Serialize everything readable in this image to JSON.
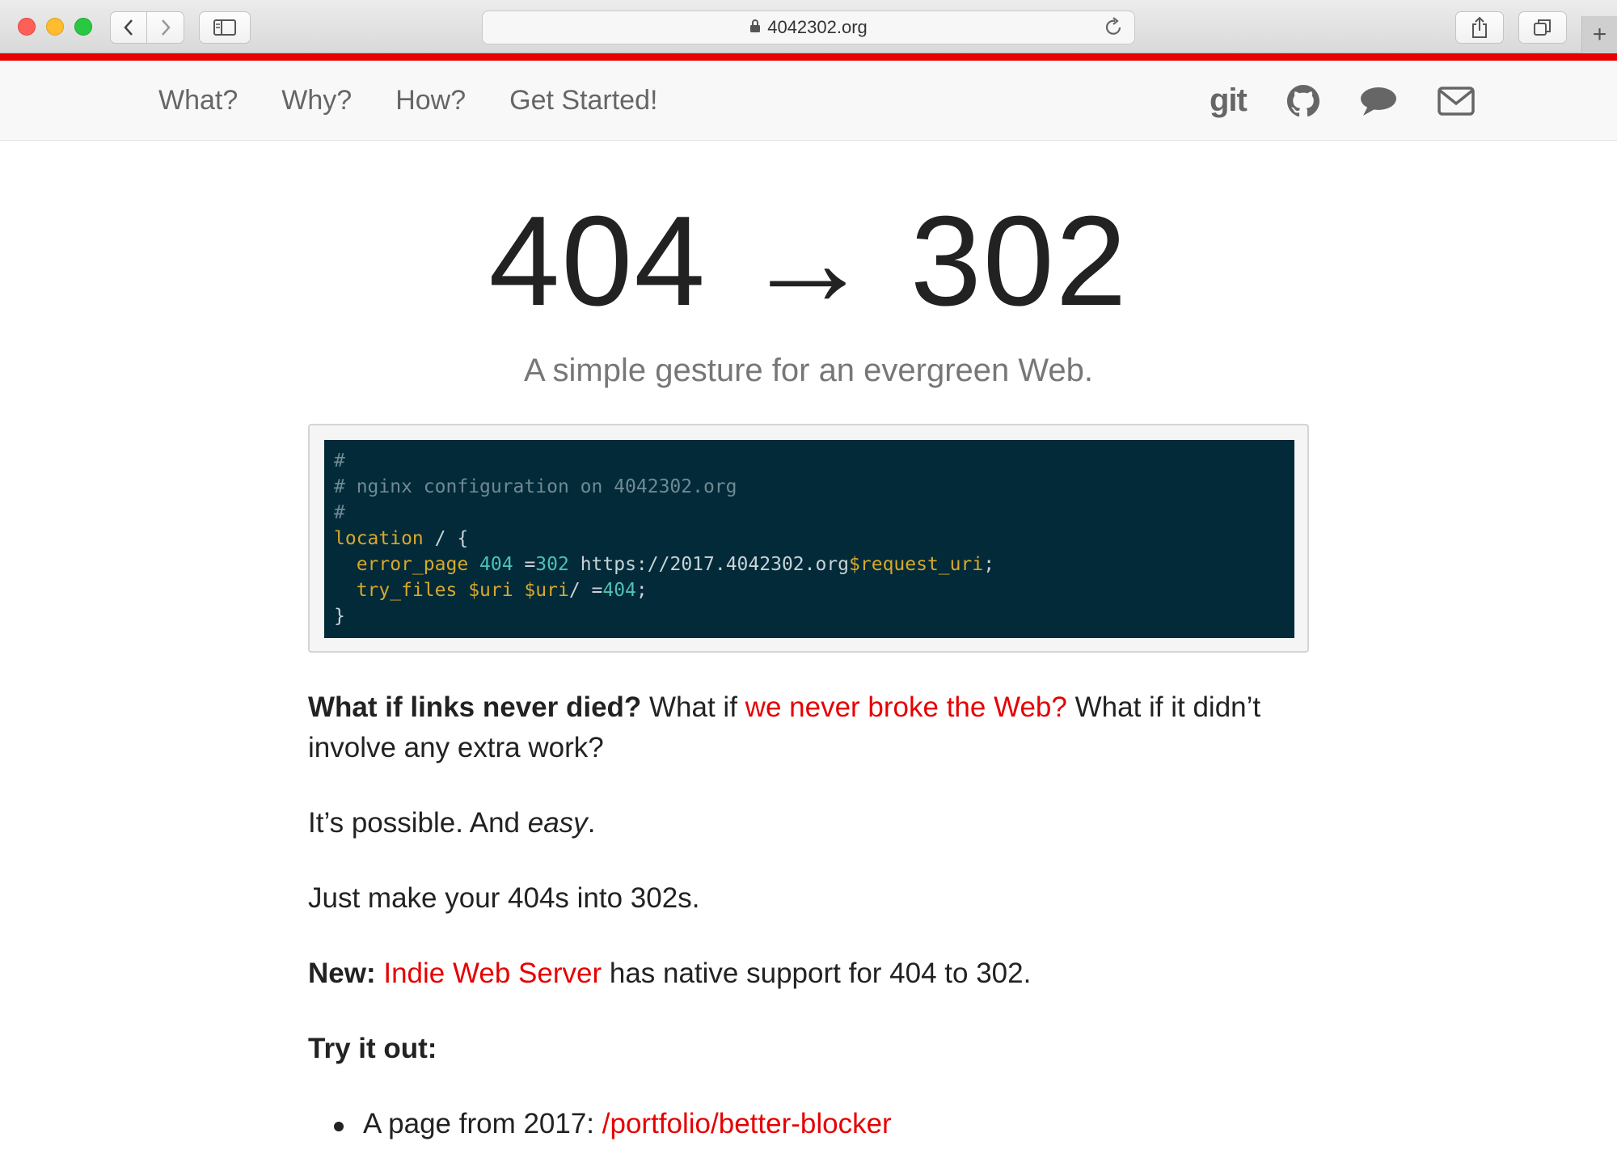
{
  "browser": {
    "url": "4042302.org"
  },
  "nav": {
    "links": [
      "What?",
      "Why?",
      "How?",
      "Get Started!"
    ],
    "git_label": "git",
    "icons": [
      "git-icon",
      "github-icon",
      "chat-icon",
      "mail-icon"
    ]
  },
  "hero": {
    "title": "404 → 302",
    "subtitle": "A simple gesture for an evergreen Web."
  },
  "code": {
    "line1": "#",
    "line2": "# nginx configuration on 4042302.org",
    "line3": "#",
    "line4_kw": "location",
    "line4_rest": " / {",
    "line5_kw": "error_page",
    "line5_n1": "404",
    "line5_eq": " =",
    "line5_n2": "302",
    "line5_url": " https://2017.4042302.org",
    "line5_var": "$request_uri",
    "line5_end": ";",
    "line6_kw": "try_files",
    "line6_vars": "$uri $uri",
    "line6_mid": "/ =",
    "line6_n": "404",
    "line6_end": ";",
    "line7": "}"
  },
  "content": {
    "p1_bold": "What if links never died?",
    "p1_text1": " What if ",
    "p1_link": "we never broke the Web?",
    "p1_text2": " What if it didn’t involve any extra work?",
    "p2_text": "It’s possible. And ",
    "p2_italic": "easy",
    "p2_end": ".",
    "p3": "Just make your 404s into 302s.",
    "p4_bold": "New:",
    "p4_link": "Indie Web Server",
    "p4_text": " has native support for 404 to 302.",
    "p5_bold": "Try it out:",
    "li1_text": "A page from 2017: ",
    "li1_link": "/portfolio/better-blocker"
  },
  "colors": {
    "accent": "#e60000",
    "code_bg": "#022a38",
    "code_keyword": "#d9a82a",
    "code_number": "#4ec1b5"
  }
}
